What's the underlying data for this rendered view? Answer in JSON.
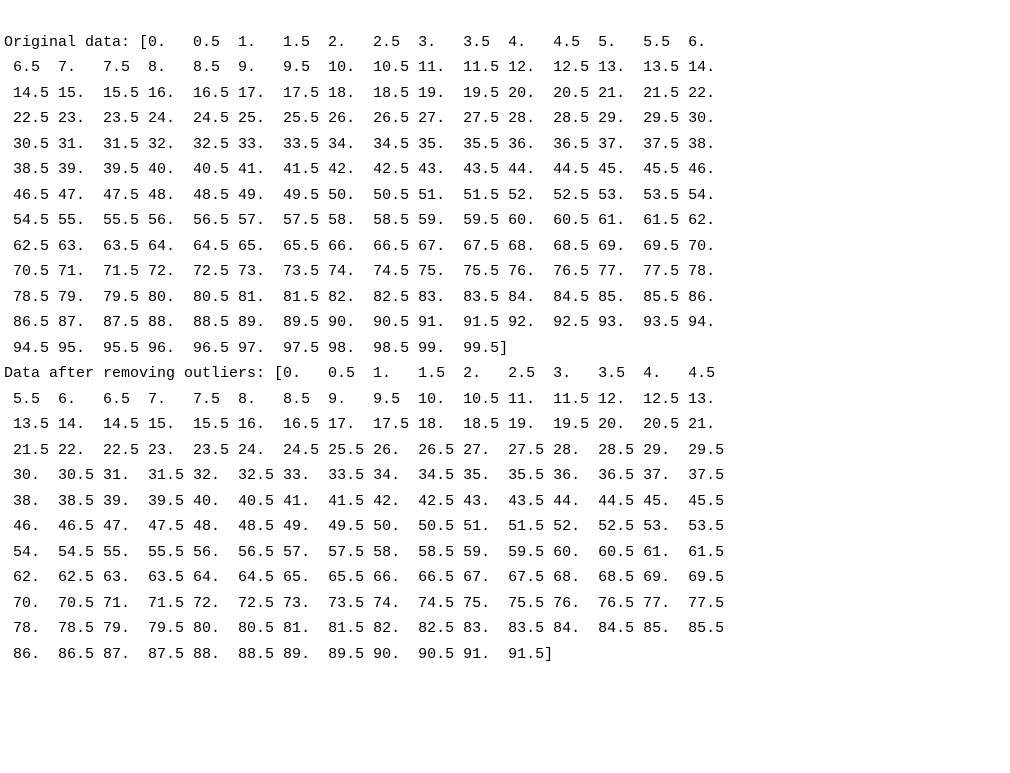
{
  "original_label": "Original data:",
  "filtered_label": "Data after removing outliers:",
  "original_data": [
    0,
    0.5,
    1,
    1.5,
    2,
    2.5,
    3,
    3.5,
    4,
    4.5,
    5,
    5.5,
    6,
    6.5,
    7,
    7.5,
    8,
    8.5,
    9,
    9.5,
    10,
    10.5,
    11,
    11.5,
    12,
    12.5,
    13,
    13.5,
    14,
    14.5,
    15,
    15.5,
    16,
    16.5,
    17,
    17.5,
    18,
    18.5,
    19,
    19.5,
    20,
    20.5,
    21,
    21.5,
    22,
    22.5,
    23,
    23.5,
    24,
    24.5,
    25,
    25.5,
    26,
    26.5,
    27,
    27.5,
    28,
    28.5,
    29,
    29.5,
    30,
    30.5,
    31,
    31.5,
    32,
    32.5,
    33,
    33.5,
    34,
    34.5,
    35,
    35.5,
    36,
    36.5,
    37,
    37.5,
    38,
    38.5,
    39,
    39.5,
    40,
    40.5,
    41,
    41.5,
    42,
    42.5,
    43,
    43.5,
    44,
    44.5,
    45,
    45.5,
    46,
    46.5,
    47,
    47.5,
    48,
    48.5,
    49,
    49.5,
    50,
    50.5,
    51,
    51.5,
    52,
    52.5,
    53,
    53.5,
    54,
    54.5,
    55,
    55.5,
    56,
    56.5,
    57,
    57.5,
    58,
    58.5,
    59,
    59.5,
    60,
    60.5,
    61,
    61.5,
    62,
    62.5,
    63,
    63.5,
    64,
    64.5,
    65,
    65.5,
    66,
    66.5,
    67,
    67.5,
    68,
    68.5,
    69,
    69.5,
    70,
    70.5,
    71,
    71.5,
    72,
    72.5,
    73,
    73.5,
    74,
    74.5,
    75,
    75.5,
    76,
    76.5,
    77,
    77.5,
    78,
    78.5,
    79,
    79.5,
    80,
    80.5,
    81,
    81.5,
    82,
    82.5,
    83,
    83.5,
    84,
    84.5,
    85,
    85.5,
    86,
    86.5,
    87,
    87.5,
    88,
    88.5,
    89,
    89.5,
    90,
    90.5,
    91,
    91.5,
    92,
    92.5,
    93,
    93.5,
    94,
    94.5,
    95,
    95.5,
    96,
    96.5,
    97,
    97.5,
    98,
    98.5,
    99,
    99.5
  ],
  "filtered_data": [
    0,
    0.5,
    1,
    1.5,
    2,
    2.5,
    3,
    3.5,
    4,
    4.5,
    5.5,
    6,
    6.5,
    7,
    7.5,
    8,
    8.5,
    9,
    9.5,
    10,
    10.5,
    11,
    11.5,
    12,
    12.5,
    13,
    13.5,
    14,
    14.5,
    15,
    15.5,
    16,
    16.5,
    17,
    17.5,
    18,
    18.5,
    19,
    19.5,
    20,
    20.5,
    21,
    21.5,
    22,
    22.5,
    23,
    23.5,
    24,
    24.5,
    25.5,
    26,
    26.5,
    27,
    27.5,
    28,
    28.5,
    29,
    29.5,
    30,
    30.5,
    31,
    31.5,
    32,
    32.5,
    33,
    33.5,
    34,
    34.5,
    35,
    35.5,
    36,
    36.5,
    37,
    37.5,
    38,
    38.5,
    39,
    39.5,
    40,
    40.5,
    41,
    41.5,
    42,
    42.5,
    43,
    43.5,
    44,
    44.5,
    45,
    45.5,
    46,
    46.5,
    47,
    47.5,
    48,
    48.5,
    49,
    49.5,
    50,
    50.5,
    51,
    51.5,
    52,
    52.5,
    53,
    53.5,
    54,
    54.5,
    55,
    55.5,
    56,
    56.5,
    57,
    57.5,
    58,
    58.5,
    59,
    59.5,
    60,
    60.5,
    61,
    61.5,
    62,
    62.5,
    63,
    63.5,
    64,
    64.5,
    65,
    65.5,
    66,
    66.5,
    67,
    67.5,
    68,
    68.5,
    69,
    69.5,
    70,
    70.5,
    71,
    71.5,
    72,
    72.5,
    73,
    73.5,
    74,
    74.5,
    75,
    75.5,
    76,
    76.5,
    77,
    77.5,
    78,
    78.5,
    79,
    79.5,
    80,
    80.5,
    81,
    81.5,
    82,
    82.5,
    83,
    83.5,
    84,
    84.5,
    85,
    85.5,
    86,
    86.5,
    87,
    87.5,
    88,
    88.5,
    89,
    89.5,
    90,
    90.5,
    91,
    91.5
  ],
  "formatting": {
    "line_width": 84,
    "indent": " "
  }
}
